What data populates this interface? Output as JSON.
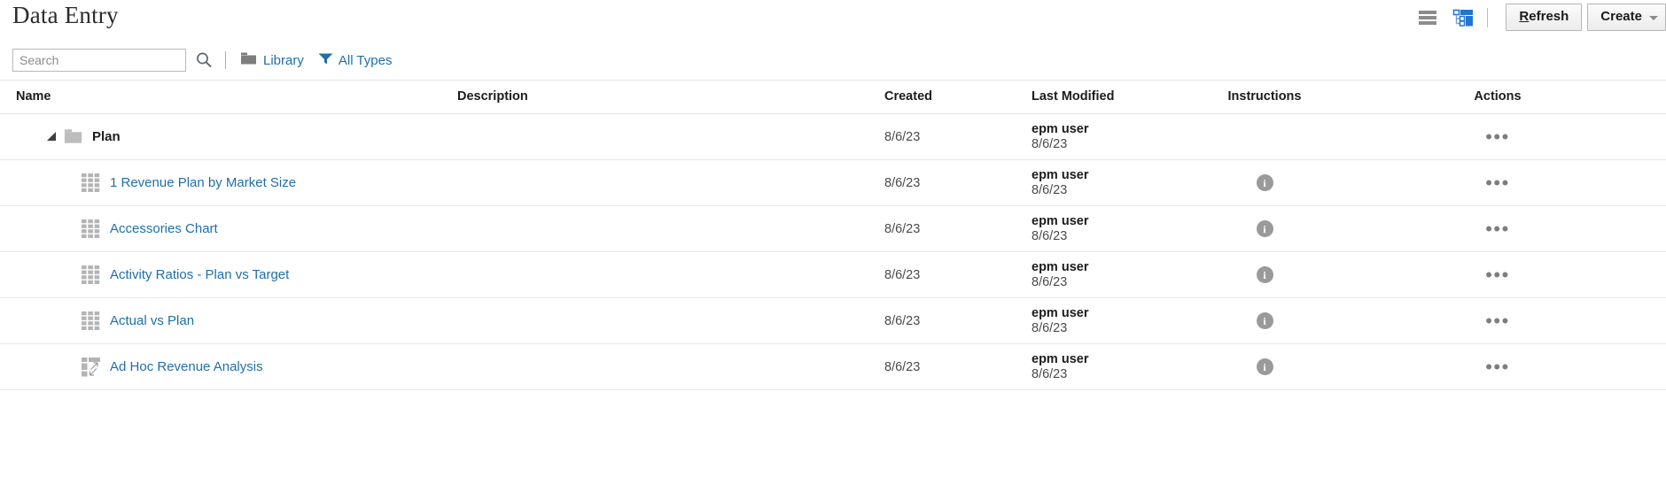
{
  "header": {
    "title": "Data Entry",
    "view_list_icon": "list-view-icon",
    "view_tree_icon": "tree-view-icon",
    "refresh_label_accesskey": "R",
    "refresh_label_rest": "efresh",
    "create_label": "Create"
  },
  "toolbar": {
    "search_placeholder": "Search",
    "search_value": "",
    "search_icon": "search-icon",
    "library_label": "Library",
    "library_icon": "folder-icon",
    "all_types_label": "All Types",
    "filter_icon": "filter-icon"
  },
  "table": {
    "columns": [
      {
        "key": "name",
        "label": "Name"
      },
      {
        "key": "description",
        "label": "Description"
      },
      {
        "key": "created",
        "label": "Created"
      },
      {
        "key": "modified",
        "label": "Last Modified"
      },
      {
        "key": "instructions",
        "label": "Instructions"
      },
      {
        "key": "actions",
        "label": "Actions"
      }
    ],
    "rows": [
      {
        "type": "folder",
        "icon": "folder-icon",
        "expanded": true,
        "name": "Plan",
        "description": "",
        "created": "8/6/23",
        "modified_user": "epm user",
        "modified_date": "8/6/23",
        "has_instructions": false,
        "actions_icon": "ellipsis-icon"
      },
      {
        "type": "form",
        "icon": "grid-form-icon",
        "name": "1 Revenue Plan by Market Size",
        "description": "",
        "created": "8/6/23",
        "modified_user": "epm user",
        "modified_date": "8/6/23",
        "has_instructions": true,
        "instructions_icon": "info-icon",
        "actions_icon": "ellipsis-icon"
      },
      {
        "type": "form",
        "icon": "grid-form-icon",
        "name": "Accessories Chart",
        "description": "",
        "created": "8/6/23",
        "modified_user": "epm user",
        "modified_date": "8/6/23",
        "has_instructions": true,
        "instructions_icon": "info-icon",
        "actions_icon": "ellipsis-icon"
      },
      {
        "type": "form",
        "icon": "grid-form-icon",
        "name": "Activity Ratios - Plan vs Target",
        "description": "",
        "created": "8/6/23",
        "modified_user": "epm user",
        "modified_date": "8/6/23",
        "has_instructions": true,
        "instructions_icon": "info-icon",
        "actions_icon": "ellipsis-icon"
      },
      {
        "type": "form",
        "icon": "grid-form-icon",
        "name": "Actual vs Plan",
        "description": "",
        "created": "8/6/23",
        "modified_user": "epm user",
        "modified_date": "8/6/23",
        "has_instructions": true,
        "instructions_icon": "info-icon",
        "actions_icon": "ellipsis-icon"
      },
      {
        "type": "adhoc",
        "icon": "adhoc-grid-icon",
        "name": "Ad Hoc Revenue Analysis",
        "description": "",
        "created": "8/6/23",
        "modified_user": "epm user",
        "modified_date": "8/6/23",
        "has_instructions": true,
        "instructions_icon": "info-icon",
        "actions_icon": "ellipsis-icon"
      }
    ]
  },
  "colors": {
    "link": "#1f6fa8",
    "tree_icon_active": "#1f76d2",
    "icon_gray": "#9a9a9a",
    "border": "#e3e3e3"
  }
}
